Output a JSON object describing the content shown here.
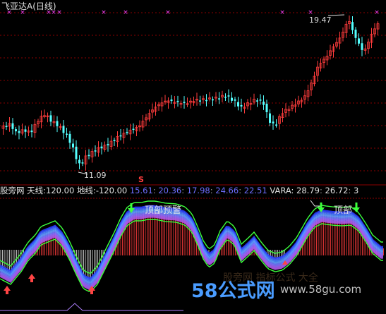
{
  "title": "飞亚达A(日线)",
  "price_panel": {
    "high_label": "19.47",
    "low_label": "11.09",
    "signal_marker": "S"
  },
  "indicator_panel": {
    "name": "股旁网",
    "tianxian_label": "天线:",
    "tianxian_value": "120.00",
    "dixian_label": "地线:",
    "dixian_value": "-120.00",
    "values": [
      "15.61",
      "20.36",
      "17.98",
      "24.66",
      "22.51"
    ],
    "vara_label": "VARA:",
    "vara_values": [
      "28.79",
      "26.72",
      "3"
    ],
    "annotation_1": "顶部预警",
    "annotation_2": "顶部"
  },
  "watermark": {
    "brand": "58公式网",
    "url": "www.58gu.com",
    "faint_text": "股旁网 指标公式 大全"
  },
  "colors": {
    "background": "#000000",
    "up_candle": "#ff3c3c",
    "down_candle": "#54ffff",
    "grid": "#8b0000",
    "signal_magenta": "#ff44ff",
    "envelope_green": "#3cff3c",
    "up_arrow": "#ff4444",
    "down_arrow": "#3cff3c",
    "band_blue": "#3d7cff"
  }
}
